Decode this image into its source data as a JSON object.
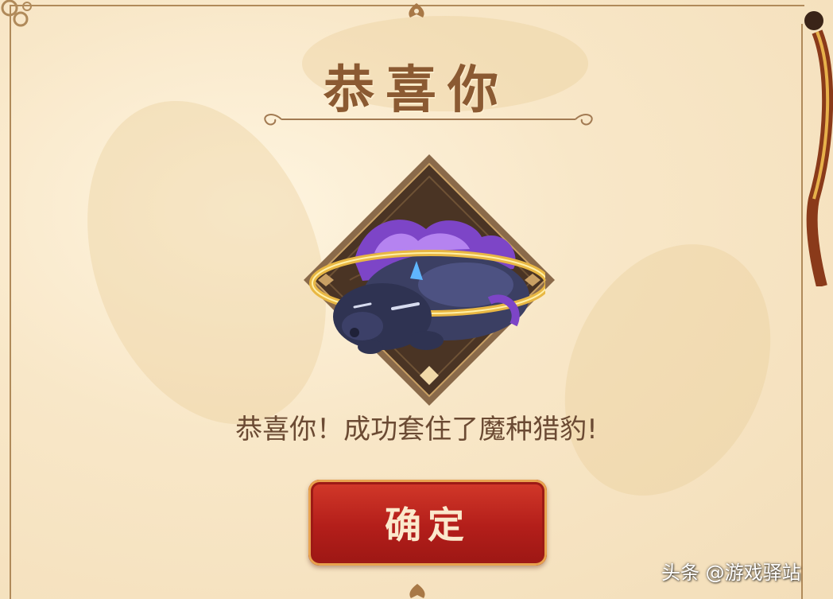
{
  "dialog": {
    "title": "恭喜你",
    "message": "恭喜你！成功套住了魔种猎豹!",
    "confirm_label": "确定"
  },
  "reward": {
    "creature_icon": "sleeping-purple-leopard-icon"
  },
  "watermark": {
    "text": "头条 @游戏驿站"
  },
  "colors": {
    "title": "#8b5a32",
    "message": "#6b4a33",
    "button": "#b31e1a",
    "button_text": "#fbe9cc",
    "frame": "#b08a5a",
    "panel": "#f6e6c8"
  }
}
